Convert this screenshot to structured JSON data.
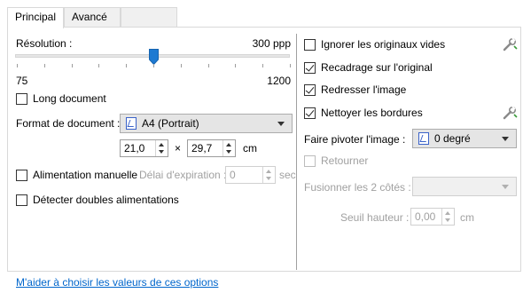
{
  "tabs": [
    {
      "label": "Principal",
      "active": true
    },
    {
      "label": "Avancé",
      "active": false
    }
  ],
  "left": {
    "resolution_label": "Résolution :",
    "resolution_value": "300 ppp",
    "slider_min": "75",
    "slider_max": "1200",
    "slider_level": 0.5,
    "long_document": {
      "label": "Long document",
      "checked": false
    },
    "format": {
      "label": "Format de document :",
      "selected": "A4 (Portrait)",
      "width": "21,0",
      "height": "29,7",
      "times": "×",
      "unit": "cm"
    },
    "manual_feed": {
      "label": "Alimentation manuelle",
      "checked": false
    },
    "timeout": {
      "label": "Délai d'expiration :",
      "value": "0",
      "unit": "sec"
    },
    "double_feed": {
      "label": "Détecter doubles alimentations",
      "checked": false
    }
  },
  "right": {
    "ignore_blank": {
      "label": "Ignorer les originaux vides",
      "checked": false
    },
    "crop": {
      "label": "Recadrage sur l'original",
      "checked": true
    },
    "straighten": {
      "label": "Redresser l'image",
      "checked": true
    },
    "clean_borders": {
      "label": "Nettoyer les bordures",
      "checked": true
    },
    "rotate": {
      "label": "Faire pivoter l'image :",
      "selected": "0 degré"
    },
    "flip": {
      "label": "Retourner",
      "checked": false
    },
    "merge": {
      "label": "Fusionner les 2 côtés :",
      "selected": ""
    },
    "height_threshold": {
      "label": "Seuil hauteur :",
      "value": "0,00",
      "unit": "cm"
    }
  },
  "help_link": "M'aider à choisir les valeurs de ces options",
  "icons": {
    "wrench": "wrench-settings-icon",
    "document": "document-portrait-icon"
  },
  "colors": {
    "accent": "#1e7ad2",
    "link": "#0066cc",
    "disabled": "#a0a0a0"
  }
}
